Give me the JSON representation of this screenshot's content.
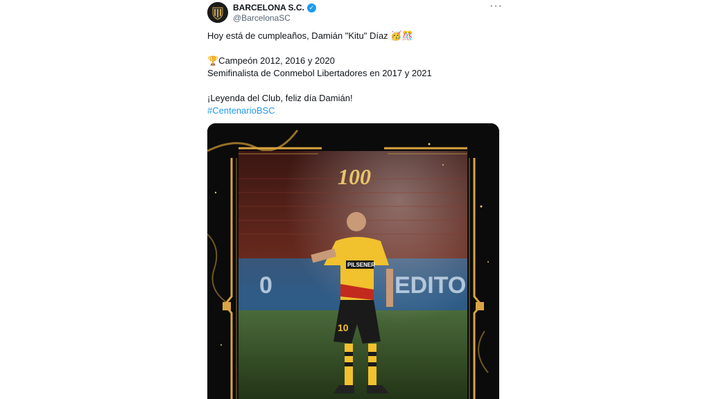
{
  "author": {
    "name": "BARCELONA S.C.",
    "handle": "@BarcelonaSC",
    "avatar_icon": "club-crest-icon"
  },
  "tweet": {
    "line1": "Hoy está de cumpleaños, Damián \"Kitu\" Díaz 🥳🎊",
    "line2": "🏆Campeón 2012, 2016 y 2020",
    "line3": "Semifinalista de Conmebol Libertadores en 2017 y 2021",
    "line4": "¡Leyenda del Club, feliz día Damián!",
    "hashtag": "#CentenarioBSC"
  },
  "image": {
    "badge": "100",
    "sponsor": "PILSENER",
    "shirt_number": "10",
    "banner_left": "0",
    "banner_right": "EDITO"
  },
  "colors": {
    "gold": "#d9a441",
    "jersey_yellow": "#f2c12e",
    "link_blue": "#1d9bf0",
    "verified_blue": "#1d9bf0"
  }
}
